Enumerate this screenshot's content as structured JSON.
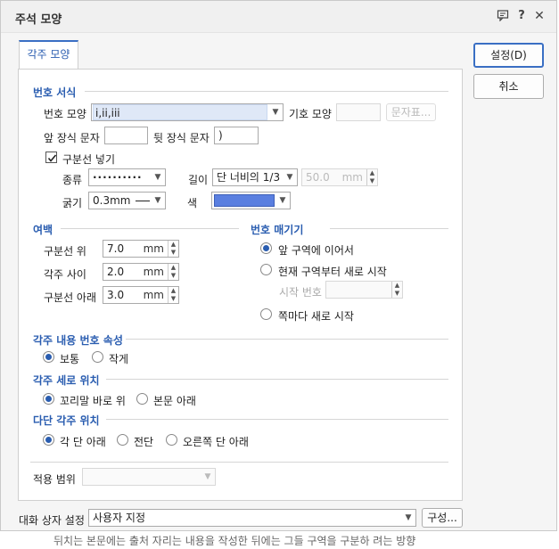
{
  "window": {
    "title": "주석 모양"
  },
  "tabs": [
    {
      "label": "각주 모양"
    }
  ],
  "buttons": {
    "ok": "설정(D)",
    "cancel": "취소",
    "config": "구성...",
    "char_table": "문자표..."
  },
  "number_format": {
    "section": "번호 서식",
    "shape_label": "번호 모양",
    "shape_value": "i,ii,iii",
    "symbol_label": "기호 모양",
    "symbol_value": "",
    "prefix_label": "앞 장식 문자",
    "prefix_value": "",
    "suffix_label": "뒷 장식 문자",
    "suffix_value": ")",
    "separator_check": "구분선 넣기",
    "type_label": "종류",
    "type_value": "··········",
    "length_label": "길이",
    "length_value": "단 너비의 1/3",
    "length_num": "50.0",
    "length_unit": "mm",
    "thick_label": "굵기",
    "thick_value": "0.3mm",
    "color_label": "색",
    "color_value": "#5a7fe0"
  },
  "margins": {
    "section": "여백",
    "rows": [
      {
        "label": "구분선 위",
        "value": "7.0",
        "unit": "mm"
      },
      {
        "label": "각주 사이",
        "value": "2.0",
        "unit": "mm"
      },
      {
        "label": "구분선 아래",
        "value": "3.0",
        "unit": "mm"
      }
    ]
  },
  "numbering": {
    "section": "번호 매기기",
    "opt_continue": "앞 구역에 이어서",
    "opt_restart": "현재 구역부터 새로 시작",
    "start_label": "시작 번호",
    "start_value": "",
    "opt_each_page": "쪽마다 새로 시작"
  },
  "content_attr": {
    "section": "각주 내용 번호 속성",
    "opt_normal": "보통",
    "opt_small": "작게"
  },
  "vertical_pos": {
    "section": "각주 세로 위치",
    "opt_below_tail": "꼬리말 바로 위",
    "opt_below_body": "본문 아래"
  },
  "column_pos": {
    "section": "다단 각주 위치",
    "opt_each_col": "각 단 아래",
    "opt_full": "전단",
    "opt_right": "오른쪽 단 아래"
  },
  "scope": {
    "label": "적용 범위",
    "value": ""
  },
  "dialog_setting": {
    "label": "대화 상자 설정",
    "value": "사용자 지정"
  },
  "background_text": "뒤치는 본문에는 출처 자리는 내용을 작성한 뒤에는 그들 구역을 구분하 려는 방향"
}
